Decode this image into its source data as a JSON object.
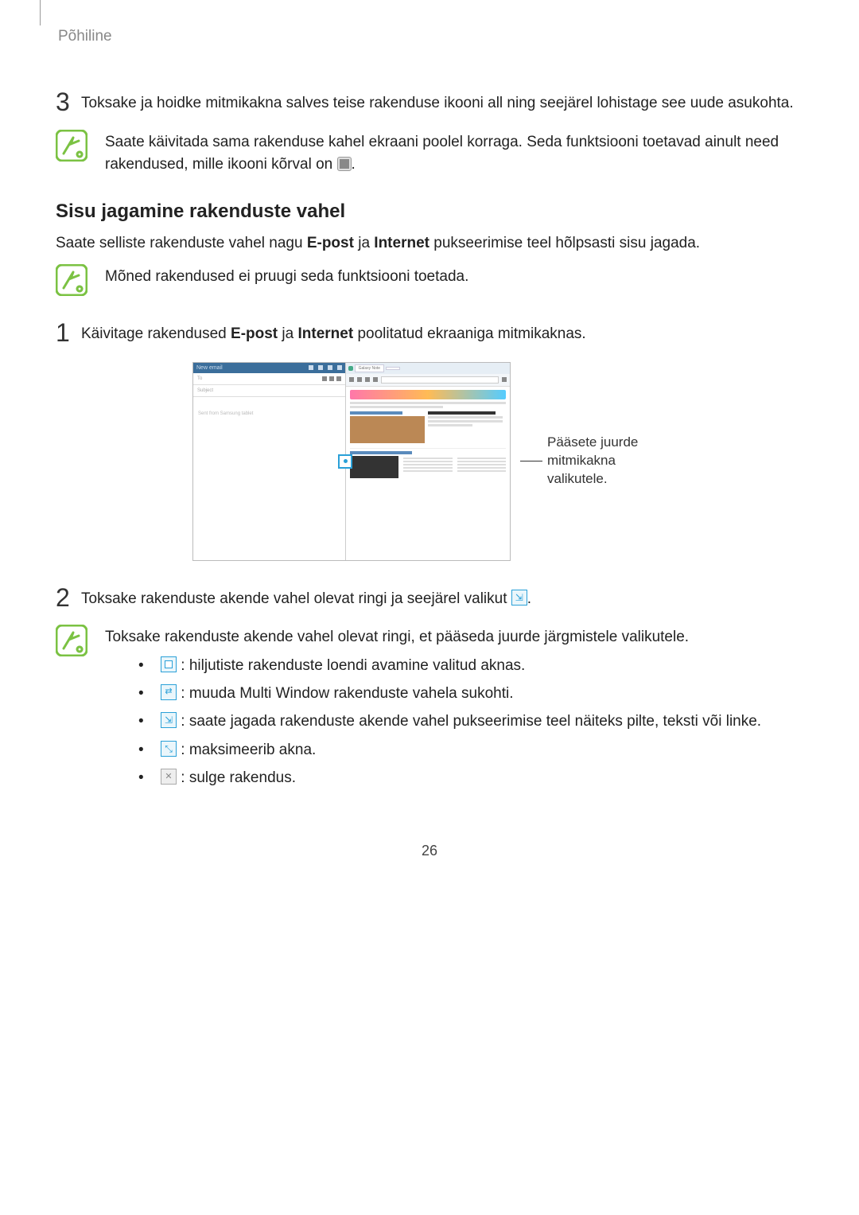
{
  "header": {
    "section": "Põhiline"
  },
  "steps": {
    "s3": {
      "num": "3",
      "text": "Toksake ja hoidke mitmikakna salves teise rakenduse ikooni all ning seejärel lohistage see uude asukohta."
    },
    "s1b": {
      "num": "1",
      "text_pre": "Käivitage rakendused ",
      "b1": "E-post",
      "mid": " ja ",
      "b2": "Internet",
      "text_post": " poolitatud ekraaniga mitmikaknas."
    },
    "s2b": {
      "num": "2",
      "text_pre": "Toksake rakenduste akende vahel olevat ringi ja seejärel valikut ",
      "period": "."
    }
  },
  "notes": {
    "n1": {
      "text_pre": "Saate käivitada sama rakenduse kahel ekraani poolel korraga. Seda funktsiooni toetavad ainult need rakendused, mille ikooni kõrval on ",
      "period": "."
    },
    "n2": {
      "text": "Mõned rakendused ei pruugi seda funktsiooni toetada."
    },
    "n3": {
      "intro": "Toksake rakenduste akende vahel olevat ringi, et pääseda juurde järgmistele valikutele.",
      "items": {
        "recent": " : hiljutiste rakenduste loendi avamine valitud aknas.",
        "swap": " : muuda Multi Window rakenduste vahela sukohti.",
        "share": " : saate jagada rakenduste akende vahel pukseerimise teel näiteks pilte, teksti või linke.",
        "max": " : maksimeerib akna.",
        "close": " : sulge rakendus."
      }
    }
  },
  "section_title": "Sisu jagamine rakenduste vahel",
  "section_body": {
    "pre": "Saate selliste rakenduste vahel nagu ",
    "b1": "E-post",
    "mid": " ja ",
    "b2": "Internet",
    "post": " pukseerimise teel hõlpsasti sisu jagada."
  },
  "figure": {
    "left_header": "New email",
    "to": "To",
    "subject": "Subject",
    "body_hint": "Sent from Samsung tablet",
    "tab": "Galaxy Note",
    "callout": "Pääsete juurde mitmikakna valikutele."
  },
  "page_number": "26"
}
